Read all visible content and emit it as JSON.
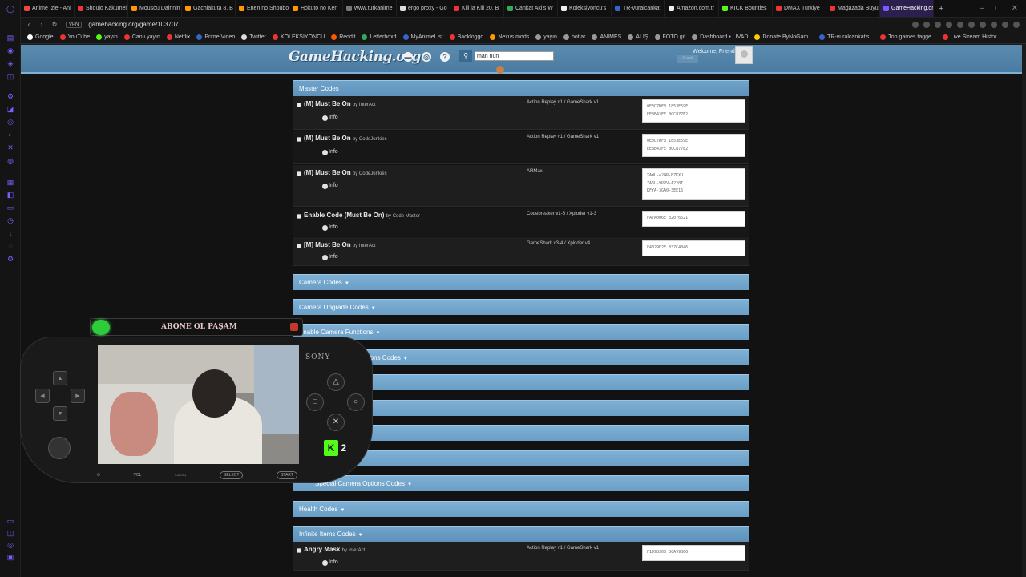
{
  "browser": {
    "tabs": [
      {
        "label": "Anime İzle - Ani",
        "color": "#e44"
      },
      {
        "label": "Shoujo Kakumei",
        "color": "#e33"
      },
      {
        "label": "Mousou Dairinin",
        "color": "#f90"
      },
      {
        "label": "Gachiakuta 8. B",
        "color": "#f90"
      },
      {
        "label": "Enen no Shouboutai",
        "color": "#f90"
      },
      {
        "label": "Hokuto no Ken",
        "color": "#f90"
      },
      {
        "label": "www.turkanime",
        "color": "#777"
      },
      {
        "label": "ergo proxy - Go",
        "color": "#ddd"
      },
      {
        "label": "Kill la Kill 20. B",
        "color": "#e33"
      },
      {
        "label": "Cankat Aki's W",
        "color": "#3a5"
      },
      {
        "label": "Koleksiyoncu's",
        "color": "#eee"
      },
      {
        "label": "TR-vuralcankat",
        "color": "#36c"
      },
      {
        "label": "Amazon.com.tr",
        "color": "#eee"
      },
      {
        "label": "KICK Bounties",
        "color": "#53fc18"
      },
      {
        "label": "DMAX Turkiye",
        "color": "#e33"
      },
      {
        "label": "Mağazada Büyü",
        "color": "#e33"
      },
      {
        "label": "GameHacking.org | Fatal F",
        "color": "#7b5cff",
        "active": true
      }
    ],
    "url": "gamehacking.org/game/103707",
    "vpn": "VPN",
    "bookmarks": [
      {
        "label": "Google",
        "color": "#fff"
      },
      {
        "label": "YouTube",
        "color": "#e33"
      },
      {
        "label": "yayın",
        "color": "#53fc18"
      },
      {
        "label": "Canlı yayın",
        "color": "#e33"
      },
      {
        "label": "Netflix",
        "color": "#e33"
      },
      {
        "label": "Prime Video",
        "color": "#36c"
      },
      {
        "label": "Twitter",
        "color": "#ddd"
      },
      {
        "label": "KOLEKSIYONCU",
        "color": "#e33"
      },
      {
        "label": "Reddit",
        "color": "#f50"
      },
      {
        "label": "Letterboxd",
        "color": "#3a5"
      },
      {
        "label": "MyAnimeList",
        "color": "#36c"
      },
      {
        "label": "Backloggd",
        "color": "#e33"
      },
      {
        "label": "Nexus mods",
        "color": "#f90"
      },
      {
        "label": "yayın",
        "color": "#999"
      },
      {
        "label": "botlar",
        "color": "#999"
      },
      {
        "label": "ANIMES",
        "color": "#999"
      },
      {
        "label": "ALIŞ",
        "color": "#999"
      },
      {
        "label": "FOTO gif",
        "color": "#999"
      },
      {
        "label": "Dashboard • LIVAD",
        "color": "#999"
      },
      {
        "label": "Donate ByNoGam...",
        "color": "#fc0"
      },
      {
        "label": "TR-vuralcankat's...",
        "color": "#36c"
      },
      {
        "label": "Top games tagge...",
        "color": "#e33"
      },
      {
        "label": "Live Stream Histor...",
        "color": "#e33"
      }
    ]
  },
  "site": {
    "logo": "GameHacking.org",
    "search_value": "man hun",
    "welcome": "Welcome, Friend",
    "guest": "Guest",
    "info_label": "Info",
    "sections": {
      "master": "Master Codes",
      "camera": "Camera Codes",
      "camera_upgrade": "Camera Upgrade Codes",
      "enable_camera": "Enable Camera Functions",
      "options": "Options Codes",
      "special_camera": "Special Camera Options Codes",
      "health": "Health Codes",
      "infinite": "Infinite Items Codes"
    },
    "codes": [
      {
        "name": "(M) Must Be On",
        "by": "by InterAct",
        "device": "Action Replay v1 / GameShark v1",
        "code": "0E3C7DF3 1853E59E\nEE8E43FE BCC877E2"
      },
      {
        "name": "(M) Must Be On",
        "by": "by CodeJunkies",
        "device": "Action Replay v1 / GameShark v1",
        "code": "0E3C7DF3 1853E59E\nEE8E43FE BCC877E2"
      },
      {
        "name": "(M) Must Be On",
        "by": "by CodeJunkies",
        "device": "ARMax",
        "code": "XAWU-A24R-BZKXU\nZA6U-9PPV-A220T\nKFYA-3GA0-3EE16"
      },
      {
        "name": "Enable Code (Must Be On)",
        "by": "by Code Master",
        "device": "Codebreaker v1-6 / Xploder v1-3",
        "code": "FA7A006E 32076521"
      },
      {
        "name": "[M] Must Be On",
        "by": "by InterAct",
        "device": "GameShark v3-4 / Xploder v4",
        "code": "F4029E2E 837C4846"
      },
      {
        "name": "Angry Mask",
        "by": "by InterAct",
        "device": "Action Replay v1 / GameShark v1",
        "code": "F1998300 BCA99B66"
      }
    ]
  },
  "overlay": {
    "abone": "ABONE OL PAŞAM",
    "sony": "SONY",
    "k_count": "2",
    "vol": "VOL",
    "select": "SELECT",
    "start": "START"
  }
}
